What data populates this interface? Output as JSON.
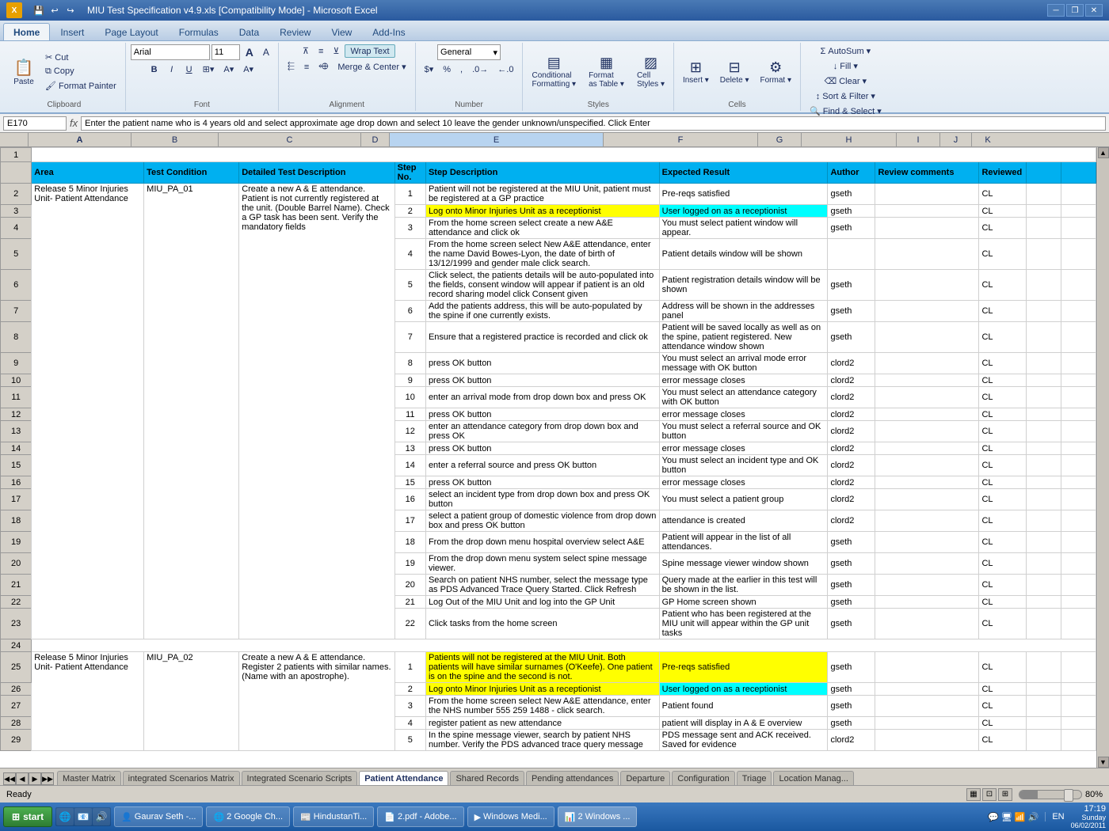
{
  "titleBar": {
    "title": "MIU Test Specification v4.9.xls [Compatibility Mode] - Microsoft Excel",
    "icons": [
      "minimize",
      "restore",
      "close"
    ],
    "appIcon": "X"
  },
  "ribbon": {
    "tabs": [
      "Home",
      "Insert",
      "Page Layout",
      "Formulas",
      "Data",
      "Review",
      "View",
      "Add-Ins"
    ],
    "activeTab": "Home",
    "groups": {
      "clipboard": {
        "label": "Clipboard",
        "buttons": [
          "Paste",
          "Cut",
          "Copy",
          "Format Painter"
        ]
      },
      "font": {
        "label": "Font",
        "fontName": "Arial",
        "fontSize": "11",
        "buttons": [
          "Bold",
          "Italic",
          "Underline"
        ]
      },
      "alignment": {
        "label": "Alignment",
        "buttons": [
          "Wrap Text",
          "Merge & Center"
        ]
      },
      "number": {
        "label": "Number",
        "format": "General"
      },
      "styles": {
        "label": "Styles",
        "buttons": [
          "Conditional Formatting",
          "Format as Table",
          "Cell Styles"
        ]
      },
      "cells": {
        "label": "Cells",
        "buttons": [
          "Insert",
          "Delete",
          "Format"
        ]
      },
      "editing": {
        "label": "Editing",
        "buttons": [
          "AutoSum",
          "Fill",
          "Clear",
          "Sort & Filter",
          "Find & Select"
        ]
      }
    }
  },
  "formulaBar": {
    "nameBox": "E170",
    "formula": "Enter the patient name who is 4 years old and select approximate age drop down and select 10 leave the gender unknown/unspecified. Click Enter"
  },
  "columns": {
    "widths": [
      36,
      130,
      110,
      200,
      40,
      280,
      195,
      60,
      130,
      60
    ],
    "labels": [
      "",
      "A",
      "B",
      "C",
      "D",
      "E",
      "F",
      "G",
      "H",
      "I",
      "J",
      "K"
    ]
  },
  "headers": {
    "row": [
      "Area",
      "Test Condition",
      "Detailed Test Description",
      "Step No.",
      "Step Description",
      "Expected Result",
      "Author",
      "Review comments",
      "Reviewed"
    ]
  },
  "rows": [
    {
      "rowNum": 1,
      "cells": [
        "",
        "",
        "",
        "",
        "",
        "",
        "",
        "",
        ""
      ]
    },
    {
      "rowNum": 2,
      "cells": [
        "Release 5 Minor Injuries Unit- Patient Attendance",
        "MIU_PA_01",
        "Create a new A & E attendance. Patient is not currently registered at the unit. (Double Barrel Name). Check a GP task has been sent. Verify the mandatory fields",
        "1",
        "Patient will not be registered at the MIU Unit, patient must be registered at a GP practice",
        "Pre-reqs satisfied",
        "gseth",
        "",
        "CL"
      ]
    },
    {
      "rowNum": 3,
      "cells": [
        "",
        "",
        "",
        "2",
        "Log onto Minor Injuries Unit as a receptionist",
        "User logged on as a receptionist",
        "gseth",
        "",
        "CL"
      ],
      "highlight": "yellow-step"
    },
    {
      "rowNum": 4,
      "cells": [
        "",
        "",
        "",
        "3",
        "From the home screen select create a new A&E attendance and click ok",
        "You must select patient window will appear.",
        "gseth",
        "",
        "CL"
      ]
    },
    {
      "rowNum": 5,
      "cells": [
        "",
        "",
        "",
        "4",
        "From the home screen select New A&E attendance, enter the name David Bowes-Lyon, the date of birth of 13/12/1999 and gender male click search.",
        "Patient details window will be shown",
        "",
        "",
        "CL"
      ]
    },
    {
      "rowNum": 6,
      "cells": [
        "",
        "",
        "",
        "5",
        "Click select, the patients details will be auto-populated into the fields, consent window will appear if patient is an old record sharing model click Consent given",
        "Patient registration details window will be shown",
        "gseth",
        "",
        "CL"
      ]
    },
    {
      "rowNum": 7,
      "cells": [
        "",
        "",
        "",
        "6",
        "Add the patients address, this will be auto-populated by the spine if one currently exists.",
        "Address will be shown in the addresses panel",
        "gseth",
        "",
        "CL"
      ]
    },
    {
      "rowNum": 8,
      "cells": [
        "",
        "",
        "",
        "7",
        "Ensure that a registered practice is recorded and click ok",
        "Patient will be saved locally as well as on the spine, patient registered. New attendance window shown",
        "gseth",
        "",
        "CL"
      ]
    },
    {
      "rowNum": 9,
      "cells": [
        "",
        "",
        "",
        "8",
        "press OK button",
        "You must select an arrival mode error message with OK button",
        "clord2",
        "",
        "CL"
      ]
    },
    {
      "rowNum": 10,
      "cells": [
        "",
        "",
        "",
        "9",
        "press OK button",
        "error message closes",
        "clord2",
        "",
        "CL"
      ]
    },
    {
      "rowNum": 11,
      "cells": [
        "",
        "",
        "",
        "10",
        "enter an arrival mode from drop down box and press OK",
        "You must select an attendance category with OK button",
        "clord2",
        "",
        "CL"
      ]
    },
    {
      "rowNum": 12,
      "cells": [
        "",
        "",
        "",
        "11",
        "press OK button",
        "error message closes",
        "clord2",
        "",
        "CL"
      ]
    },
    {
      "rowNum": 13,
      "cells": [
        "",
        "",
        "",
        "12",
        "enter an attendance category from drop down box and press OK",
        "You must select a referral source and OK button",
        "clord2",
        "",
        "CL"
      ]
    },
    {
      "rowNum": 14,
      "cells": [
        "",
        "",
        "",
        "13",
        "press OK button",
        "error message closes",
        "clord2",
        "",
        "CL"
      ]
    },
    {
      "rowNum": 15,
      "cells": [
        "",
        "",
        "",
        "14",
        "enter a referral source and press OK button",
        "You must select an incident type and OK button",
        "clord2",
        "",
        "CL"
      ]
    },
    {
      "rowNum": 16,
      "cells": [
        "",
        "",
        "",
        "15",
        "press OK button",
        "error message closes",
        "clord2",
        "",
        "CL"
      ]
    },
    {
      "rowNum": 17,
      "cells": [
        "",
        "",
        "",
        "16",
        "select an incident type from drop down box and press OK button",
        "You must select a patient group",
        "clord2",
        "",
        "CL"
      ]
    },
    {
      "rowNum": 18,
      "cells": [
        "",
        "",
        "",
        "17",
        "select a patient group of domestic violence from drop down box and press OK button",
        "attendance is created",
        "clord2",
        "",
        "CL"
      ]
    },
    {
      "rowNum": 19,
      "cells": [
        "",
        "",
        "",
        "18",
        "From the drop down menu hospital overview select A&E",
        "Patient will appear in the list of all attendances.",
        "gseth",
        "",
        "CL"
      ]
    },
    {
      "rowNum": 20,
      "cells": [
        "",
        "",
        "",
        "19",
        "From the drop down menu system select spine message viewer.",
        "Spine message viewer window shown",
        "gseth",
        "",
        "CL"
      ]
    },
    {
      "rowNum": 21,
      "cells": [
        "",
        "",
        "",
        "20",
        "Search on patient NHS number, select the message type as PDS Advanced Trace Query Started. Click Refresh",
        "Query made at the earlier in this test will be shown in the list.",
        "gseth",
        "",
        "CL"
      ]
    },
    {
      "rowNum": 22,
      "cells": [
        "",
        "",
        "",
        "21",
        "Log Out of the MIU Unit and log into the GP Unit",
        "GP Home screen shown",
        "gseth",
        "",
        "CL"
      ]
    },
    {
      "rowNum": 23,
      "cells": [
        "",
        "",
        "",
        "22",
        "Click tasks from the home screen",
        "Patient who has been registered at the MIU unit will appear within the GP unit tasks",
        "gseth",
        "",
        "CL"
      ]
    },
    {
      "rowNum": 24,
      "cells": [
        "",
        "",
        "",
        "",
        "",
        "",
        "",
        "",
        ""
      ]
    },
    {
      "rowNum": 25,
      "cells": [
        "Release 5 Minor Injuries Unit- Patient Attendance",
        "MIU_PA_02",
        "Create a new A & E attendance. Register 2 patients with similar names. (Name with an apostrophe).",
        "1",
        "Patients will not be registered at the MIU Unit. Both patients will have similar surnames (O'Keefe). One patient is on the spine and the second is not.",
        "Pre-reqs satisfied",
        "gseth",
        "",
        "CL"
      ],
      "highlight": "yellow"
    },
    {
      "rowNum": 26,
      "cells": [
        "",
        "",
        "",
        "2",
        "Log onto Minor Injuries Unit as a receptionist",
        "User logged on as a receptionist",
        "gseth",
        "",
        "CL"
      ],
      "highlight": "yellow-step"
    },
    {
      "rowNum": 27,
      "cells": [
        "",
        "",
        "",
        "3",
        "From the home screen select New A&E attendance, enter the NHS number 555 259 1488 - click search.",
        "Patient found",
        "gseth",
        "",
        "CL"
      ]
    },
    {
      "rowNum": 28,
      "cells": [
        "",
        "",
        "",
        "4",
        "register patient as new attendance",
        "patient will display in A & E overview",
        "gseth",
        "",
        "CL"
      ]
    },
    {
      "rowNum": 29,
      "cells": [
        "",
        "",
        "",
        "5",
        "In the spine message viewer, search by patient NHS number. Verify the PDS advanced trace query message",
        "PDS message sent and ACK received. Saved for evidence",
        "clord2",
        "",
        "CL"
      ]
    }
  ],
  "sheetTabs": [
    {
      "label": "Master Matrix",
      "active": false
    },
    {
      "label": "Integrated Scenarios Matrix",
      "active": false
    },
    {
      "label": "Integrated Scenario Scripts",
      "active": false
    },
    {
      "label": "Patient Attendance",
      "active": true
    },
    {
      "label": "Shared Records",
      "active": false
    },
    {
      "label": "Pending attendances",
      "active": false
    },
    {
      "label": "Departure",
      "active": false
    },
    {
      "label": "Configuration",
      "active": false
    },
    {
      "label": "Triage",
      "active": false
    },
    {
      "label": "Location Manag...",
      "active": false
    }
  ],
  "statusBar": {
    "status": "Ready",
    "zoom": "80%"
  },
  "taskbar": {
    "startLabel": "start",
    "items": [
      {
        "label": "Gaurav Seth -...",
        "active": false
      },
      {
        "label": "2 Google Ch...",
        "active": false
      },
      {
        "label": "HindustanTi...",
        "active": false
      },
      {
        "label": "2.pdf - Adobe...",
        "active": false
      },
      {
        "label": "Windows Medi...",
        "active": false
      },
      {
        "label": "2 Windows ...",
        "active": false
      }
    ],
    "trayItems": [
      "EN",
      "17:19",
      "Sunday",
      "06/02/2011"
    ]
  }
}
